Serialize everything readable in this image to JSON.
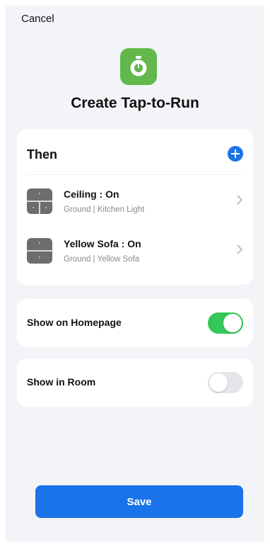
{
  "header": {
    "cancel_label": "Cancel",
    "title": "Create Tap-to-Run",
    "app_icon": "stopwatch-icon",
    "app_icon_color": "#62b84a"
  },
  "then_section": {
    "title": "Then",
    "add_icon": "plus-circle-icon",
    "actions": [
      {
        "title": "Ceiling : On",
        "subtitle": "Ground  | Kitchen Light",
        "icon": "switch-panel-icon"
      },
      {
        "title": "Yellow Sofa : On",
        "subtitle": "Ground  | Yellow Sofa",
        "icon": "switch-panel-icon"
      }
    ]
  },
  "toggles": {
    "show_on_homepage": {
      "label": "Show on Homepage",
      "on": true
    },
    "show_in_room": {
      "label": "Show in Room",
      "on": false
    }
  },
  "footer": {
    "save_label": "Save"
  },
  "colors": {
    "accent": "#1a73e8",
    "switch_on": "#34c759",
    "switch_off": "#e6e6ea",
    "background": "#f3f4f7"
  }
}
